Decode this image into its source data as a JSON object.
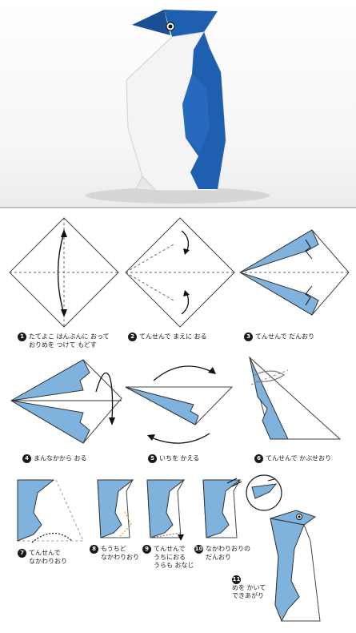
{
  "colors": {
    "blue": "#1f5fb0",
    "light_blue": "#7fb3de",
    "paper_white": "#ffffff",
    "line": "#444444"
  },
  "steps": [
    {
      "n": "1",
      "line1": "たてよこ はんぶんに おって",
      "line2": "おりめを つけて もどす"
    },
    {
      "n": "2",
      "line1": "てんせんで まえに おる",
      "line2": ""
    },
    {
      "n": "3",
      "line1": "てんせんで だんおり",
      "line2": ""
    },
    {
      "n": "4",
      "line1": "まんなかから おる",
      "line2": ""
    },
    {
      "n": "5",
      "line1": "いちを かえる",
      "line2": ""
    },
    {
      "n": "6",
      "line1": "てんせんで かぶせおり",
      "line2": ""
    },
    {
      "n": "7",
      "line1": "てんせんで",
      "line2": "なかわりおり"
    },
    {
      "n": "8",
      "line1": "もうちど",
      "line2": "なかわりおり"
    },
    {
      "n": "9",
      "line1": "てんせんで",
      "line2": "うちにおる",
      "line3": "うらも おなじ"
    },
    {
      "n": "10",
      "line1": "なかわりおりの",
      "line2": "だんおり"
    },
    {
      "n": "11",
      "line1": "めを かいて",
      "line2": "できあがり"
    }
  ]
}
